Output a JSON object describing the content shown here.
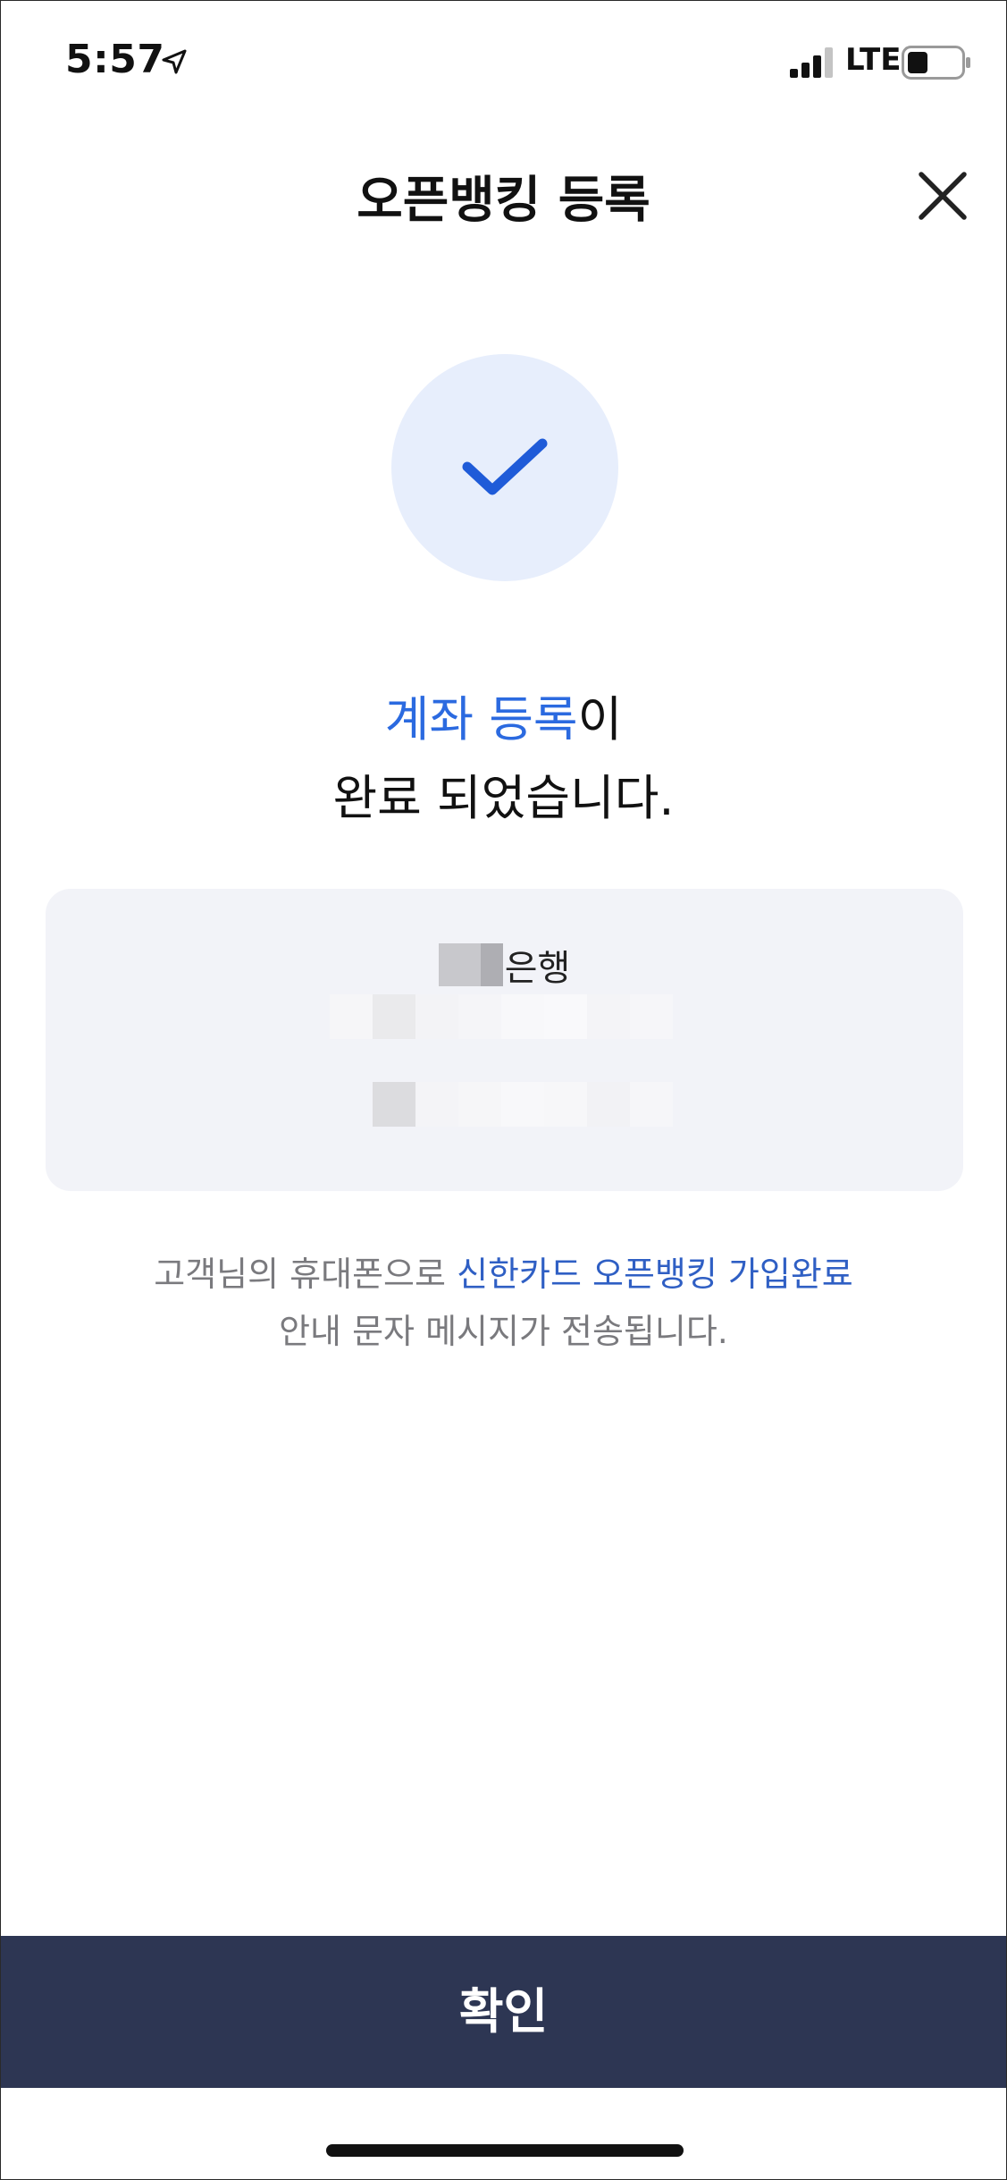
{
  "status_bar": {
    "time": "5:57",
    "network": "LTE",
    "location_icon": "location-arrow-icon",
    "signal_icon": "cellular-signal-icon",
    "battery_icon": "battery-icon"
  },
  "header": {
    "title": "오픈뱅킹 등록",
    "close_icon": "close-icon"
  },
  "status": {
    "icon": "checkmark-icon",
    "heading_highlight": "계좌 등록",
    "heading_rest_line1": "이",
    "heading_line2": "완료 되었습니다."
  },
  "account_card": {
    "bank_name_suffix": "은행"
  },
  "notice": {
    "text_before": "고객님의 휴대폰으로 ",
    "text_highlight": "신한카드 오픈뱅킹 가입완료",
    "text_line2": "안내 문자 메시지가 전송됩니다."
  },
  "footer": {
    "confirm_label": "확인"
  },
  "colors": {
    "accent": "#2b6ae0",
    "button_bg": "#2d3653",
    "circle_bg": "#e7eefc",
    "card_bg": "#f2f3f8"
  }
}
